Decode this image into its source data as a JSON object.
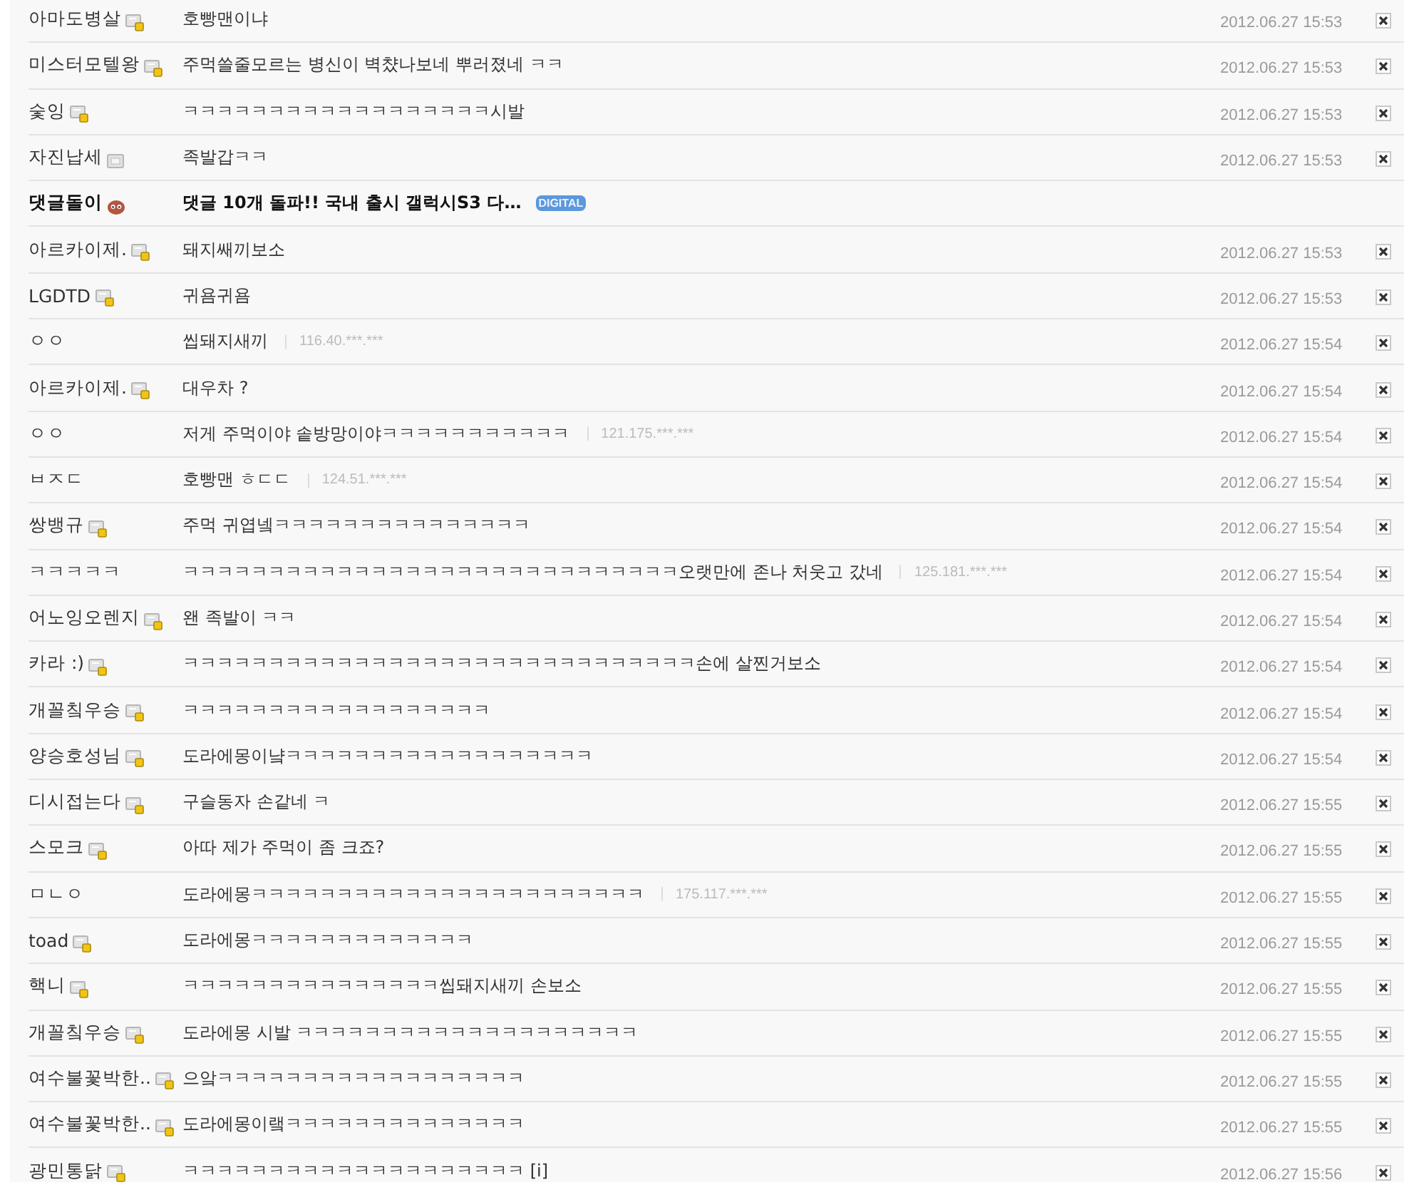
{
  "comments": [
    {
      "kind": "comment",
      "author": "아마도병살",
      "author_badge": {
        "kind": "member"
      },
      "text": "호빵맨이냐",
      "date": "2012.06.27 15:53"
    },
    {
      "kind": "comment",
      "author": "미스터모텔왕",
      "author_badge": {
        "kind": "member"
      },
      "text": "주먹쓸줄모르는 병신이 벽챴나보네 뿌러졌네 ㅋㅋ",
      "date": "2012.06.27 15:53"
    },
    {
      "kind": "comment",
      "author": "숯잉",
      "author_badge": {
        "kind": "member"
      },
      "text": "ㅋㅋㅋㅋㅋㅋㅋㅋㅋㅋㅋㅋㅋㅋㅋㅋㅋㅋ시발",
      "date": "2012.06.27 15:53"
    },
    {
      "kind": "comment",
      "author": "자진납세",
      "author_badge": {
        "kind": "plain"
      },
      "text": "족발갑ㅋㅋ",
      "date": "2012.06.27 15:53"
    },
    {
      "kind": "notice",
      "author": "댓글돌이",
      "author_badge": {
        "kind": "bot"
      },
      "text": "댓글 10개 돌파!!  국내 출시 갤럭시S3 다…",
      "tag": "DIGITAL"
    },
    {
      "kind": "comment",
      "author": "아르카이제.",
      "author_badge": {
        "kind": "member"
      },
      "text": "돼지쌔끼보소",
      "date": "2012.06.27 15:53"
    },
    {
      "kind": "comment",
      "author": "LGDTD",
      "author_badge": {
        "kind": "member"
      },
      "text": "귀욤귀욤",
      "date": "2012.06.27 15:53"
    },
    {
      "kind": "comment",
      "author": "ㅇㅇ",
      "text": "씹돼지새끼",
      "ip": "116.40.***.***",
      "date": "2012.06.27 15:54"
    },
    {
      "kind": "comment",
      "author": "아르카이제.",
      "author_badge": {
        "kind": "member"
      },
      "text": "대우차 ?",
      "date": "2012.06.27 15:54"
    },
    {
      "kind": "comment",
      "author": "ㅇㅇ",
      "text": "저게 주먹이야 솥방망이야ㅋㅋㅋㅋㅋㅋㅋㅋㅋㅋㅋ",
      "ip": "121.175.***.***",
      "date": "2012.06.27 15:54"
    },
    {
      "kind": "comment",
      "author": "ㅂㅈㄷ",
      "text": "호빵맨 ㅎㄷㄷ",
      "ip": "124.51.***.***",
      "date": "2012.06.27 15:54"
    },
    {
      "kind": "comment",
      "author": "쌍뱅규",
      "author_badge": {
        "kind": "member"
      },
      "text": "주먹 귀엽넼ㅋㅋㅋㅋㅋㅋㅋㅋㅋㅋㅋㅋㅋㅋㅋ",
      "date": "2012.06.27 15:54"
    },
    {
      "kind": "comment",
      "author": "ㅋㅋㅋㅋㅋ",
      "text": "ㅋㅋㅋㅋㅋㅋㅋㅋㅋㅋㅋㅋㅋㅋㅋㅋㅋㅋㅋㅋㅋㅋㅋㅋㅋㅋㅋㅋㅋ오랫만에 존나 처웃고 갔네",
      "ip": "125.181.***.***",
      "date": "2012.06.27 15:54"
    },
    {
      "kind": "comment",
      "author": "어노잉오렌지",
      "author_badge": {
        "kind": "member"
      },
      "text": "왠 족발이 ㅋㅋ",
      "date": "2012.06.27 15:54"
    },
    {
      "kind": "comment",
      "author": "카라 :)",
      "author_badge": {
        "kind": "member"
      },
      "text": "ㅋㅋㅋㅋㅋㅋㅋㅋㅋㅋㅋㅋㅋㅋㅋㅋㅋㅋㅋㅋㅋㅋㅋㅋㅋㅋㅋㅋㅋㅋ손에 살찐거보소",
      "date": "2012.06.27 15:54"
    },
    {
      "kind": "comment",
      "author": "개꼴칰우승",
      "author_badge": {
        "kind": "member"
      },
      "text": "ㅋㅋㅋㅋㅋㅋㅋㅋㅋㅋㅋㅋㅋㅋㅋㅋㅋㅋ",
      "date": "2012.06.27 15:54"
    },
    {
      "kind": "comment",
      "author": "양승호성님",
      "author_badge": {
        "kind": "member"
      },
      "text": "도라에몽이냨ㅋㅋㅋㅋㅋㅋㅋㅋㅋㅋㅋㅋㅋㅋㅋㅋㅋㅋ",
      "date": "2012.06.27 15:54"
    },
    {
      "kind": "comment",
      "author": "디시접는다",
      "author_badge": {
        "kind": "member"
      },
      "text": "구슬동자 손같네 ㅋ",
      "date": "2012.06.27 15:55"
    },
    {
      "kind": "comment",
      "author": "스모크",
      "author_badge": {
        "kind": "member"
      },
      "text": "아따 제가 주먹이 좀 크죠?",
      "date": "2012.06.27 15:55"
    },
    {
      "kind": "comment",
      "author": "ㅁㄴㅇ",
      "text": "도라에몽ㅋㅋㅋㅋㅋㅋㅋㅋㅋㅋㅋㅋㅋㅋㅋㅋㅋㅋㅋㅋㅋㅋㅋ",
      "ip": "175.117.***.***",
      "date": "2012.06.27 15:55"
    },
    {
      "kind": "comment",
      "author": "toad",
      "author_badge": {
        "kind": "member"
      },
      "text": "도라에몽ㅋㅋㅋㅋㅋㅋㅋㅋㅋㅋㅋㅋㅋ",
      "date": "2012.06.27 15:55"
    },
    {
      "kind": "comment",
      "author": "핵니",
      "author_badge": {
        "kind": "member"
      },
      "text": "ㅋㅋㅋㅋㅋㅋㅋㅋㅋㅋㅋㅋㅋㅋㅋ씹돼지새끼 손보소",
      "date": "2012.06.27 15:55"
    },
    {
      "kind": "comment",
      "author": "개꼴칰우승",
      "author_badge": {
        "kind": "member"
      },
      "text": "도라에몽 시발 ㅋㅋㅋㅋㅋㅋㅋㅋㅋㅋㅋㅋㅋㅋㅋㅋㅋㅋㅋㅋ",
      "date": "2012.06.27 15:55"
    },
    {
      "kind": "comment",
      "author": "여수불꽃박한..",
      "author_badge": {
        "kind": "member"
      },
      "text": "으앜ㅋㅋㅋㅋㅋㅋㅋㅋㅋㅋㅋㅋㅋㅋㅋㅋㅋㅋ",
      "date": "2012.06.27 15:55"
    },
    {
      "kind": "comment",
      "author": "여수불꽃박한..",
      "author_badge": {
        "kind": "member"
      },
      "text": "도라에몽이랰ㅋㅋㅋㅋㅋㅋㅋㅋㅋㅋㅋㅋㅋㅋ",
      "date": "2012.06.27 15:55"
    },
    {
      "kind": "comment",
      "author": "광민통닭",
      "author_badge": {
        "kind": "member"
      },
      "text": "ㅋㅋㅋㅋㅋㅋㅋㅋㅋㅋㅋㅋㅋㅋㅋㅋㅋㅋㅋㅋ [i]",
      "date": "2012.06.27 15:56"
    }
  ]
}
